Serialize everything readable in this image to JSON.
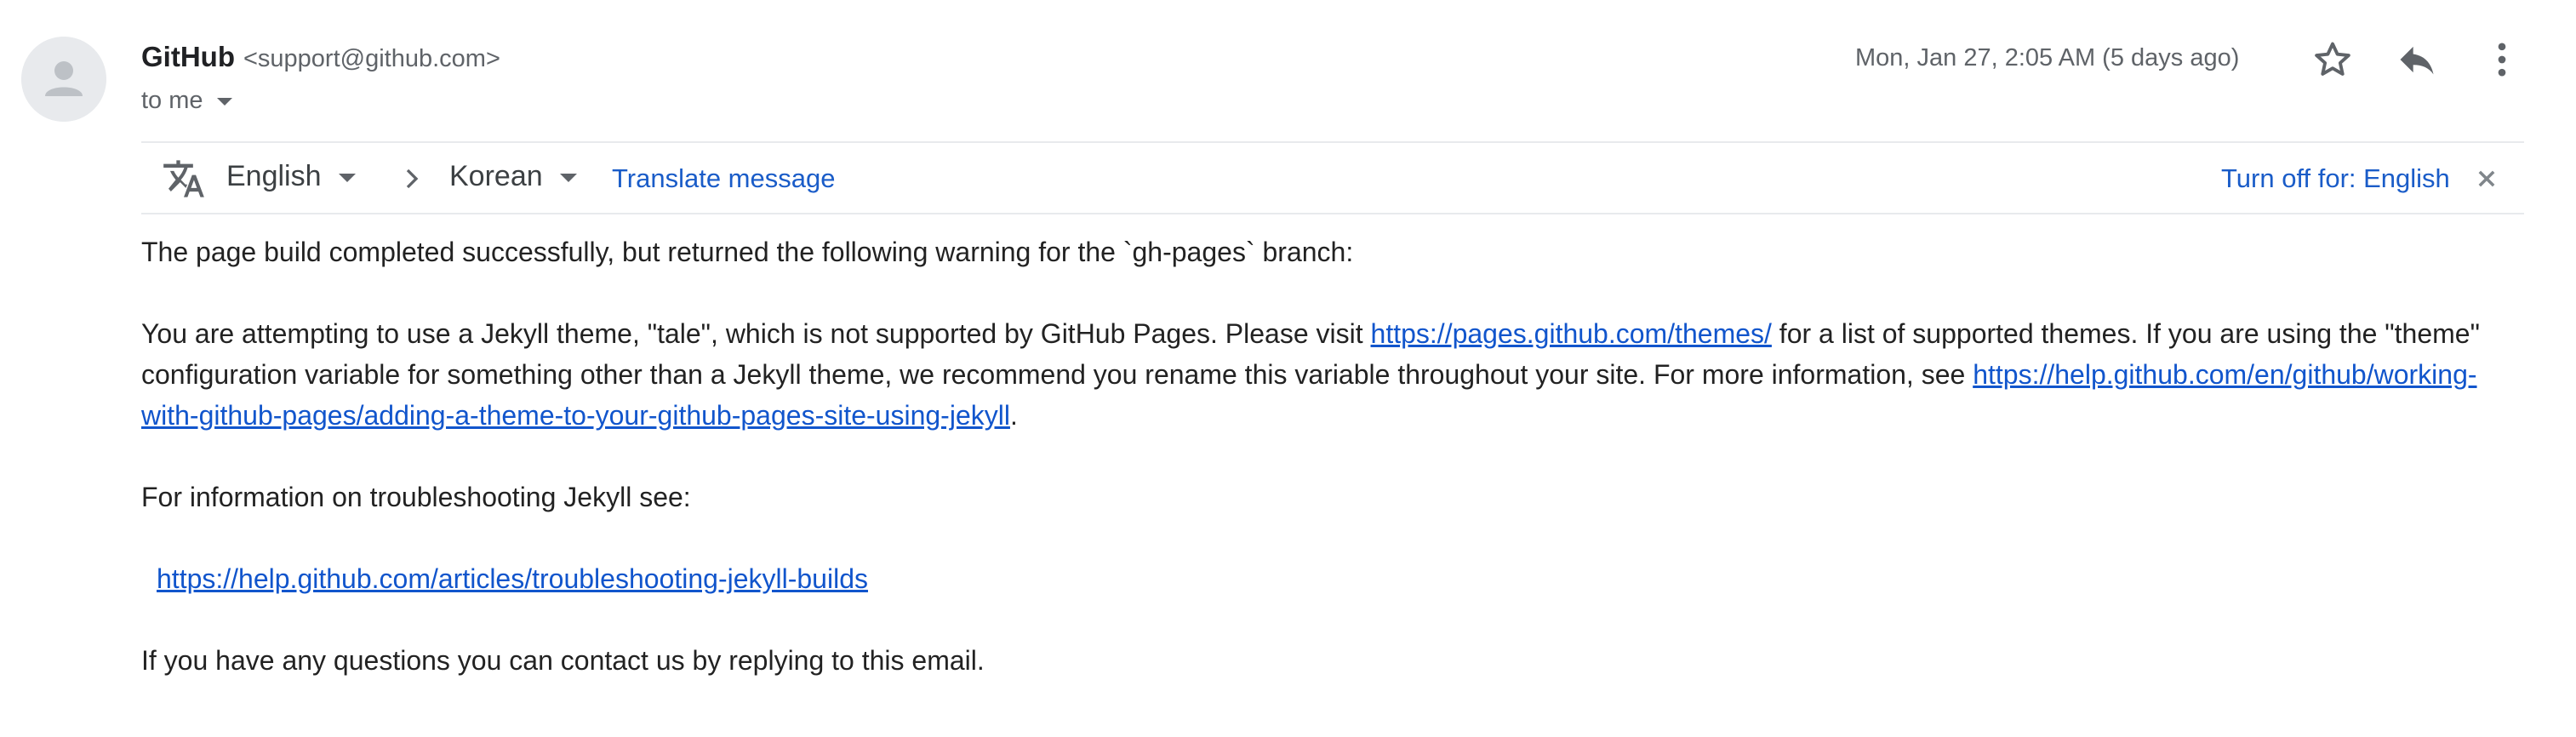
{
  "header": {
    "sender_name": "GitHub",
    "sender_email": "<support@github.com>",
    "recipient": "to me",
    "date": "Mon, Jan 27, 2:05 AM (5 days ago)",
    "icons": [
      "star-icon",
      "reply-icon",
      "more-vert-icon"
    ]
  },
  "translate": {
    "from_lang": "English",
    "to_lang": "Korean",
    "translate_label": "Translate message",
    "turn_off_label": "Turn off for: English"
  },
  "body": {
    "p1": "The page build completed successfully, but returned the following warning for the `gh-pages` branch:",
    "p2_a": "You are attempting to use a Jekyll theme, \"tale\", which is not supported by GitHub Pages. Please visit ",
    "p2_link1": "https://pages.github.com/themes/",
    "p2_b": " for a list of supported themes. If you are using the \"theme\" configuration variable for something other than a Jekyll theme, we recommend you rename this variable throughout your site. For more information, see ",
    "p2_link2": "https://help.github.com/en/github/working-with-github-pages/adding-a-theme-to-your-github-pages-site-using-jekyll",
    "p2_c": ".",
    "p3": "For information on troubleshooting Jekyll see:",
    "p4_link": "https://help.github.com/articles/troubleshooting-jekyll-builds",
    "p5": "If you have any questions you can contact us by replying to this email."
  },
  "colors": {
    "link": "#1155cc",
    "accent": "#1a5cc8",
    "muted": "#5f6368"
  }
}
